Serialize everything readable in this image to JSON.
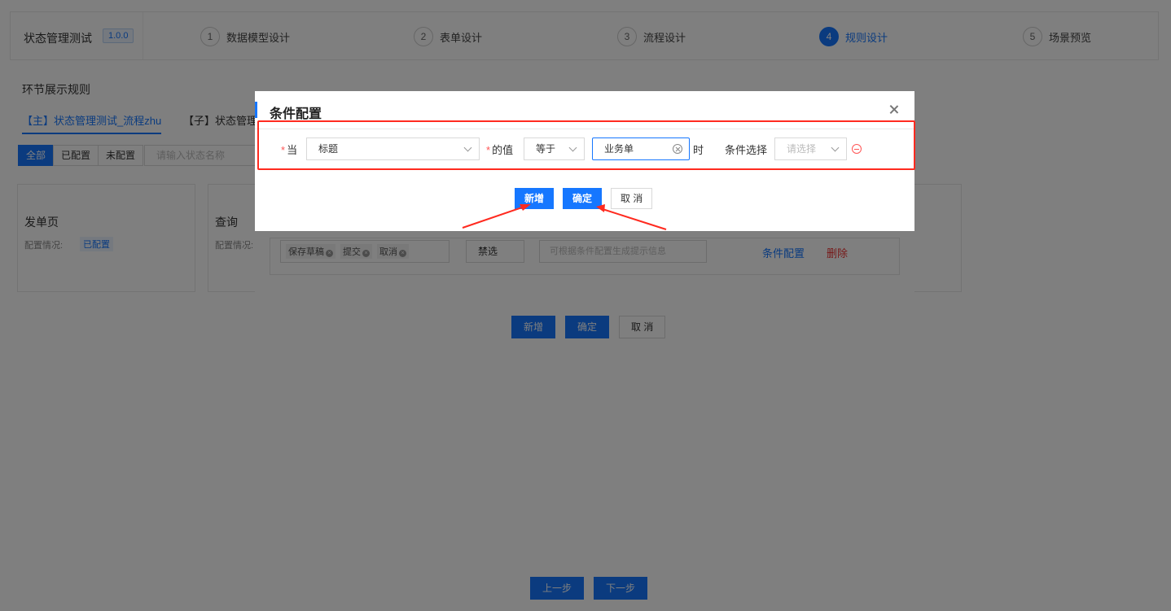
{
  "app": {
    "title": "状态管理测试",
    "version": "1.0.0"
  },
  "steps": [
    {
      "num": "1",
      "label": "数据模型设计"
    },
    {
      "num": "2",
      "label": "表单设计"
    },
    {
      "num": "3",
      "label": "流程设计"
    },
    {
      "num": "4",
      "label": "规则设计"
    },
    {
      "num": "5",
      "label": "场景预览"
    }
  ],
  "section_title": "环节展示规则",
  "process_tabs": [
    {
      "label": "【主】状态管理测试_流程zhu"
    },
    {
      "label": "【子】状态管理"
    }
  ],
  "filters": [
    "全部",
    "已配置",
    "未配置"
  ],
  "state_search_placeholder": "请输入状态名称",
  "cards": [
    {
      "title": "发单页",
      "status_label": "配置情况:",
      "status": "已配置"
    },
    {
      "title": "查询",
      "status_label": "配置情况:"
    }
  ],
  "rule_panel": {
    "tags": [
      "保存草稿",
      "提交",
      "取消"
    ],
    "action": "禁选",
    "tip_placeholder": "可根据条件配置生成提示信息",
    "condition_link": "条件配置",
    "delete_link": "删除",
    "buttons": {
      "add": "新增",
      "confirm": "确定",
      "cancel": "取 消"
    }
  },
  "footer": {
    "prev": "上一步",
    "next": "下一步"
  },
  "modal": {
    "title": "条件配置",
    "when_label": "当",
    "field_value": "标题",
    "value_label": "的值",
    "operator_value": "等于",
    "input_value": "业务单",
    "then_label": "时",
    "cond_label": "条件选择",
    "cond_placeholder": "请选择",
    "buttons": {
      "add": "新增",
      "confirm": "确定",
      "cancel": "取 消"
    }
  },
  "colors": {
    "primary": "#1677ff",
    "highlight": "#ff2a1f",
    "danger": "#ff5555"
  }
}
